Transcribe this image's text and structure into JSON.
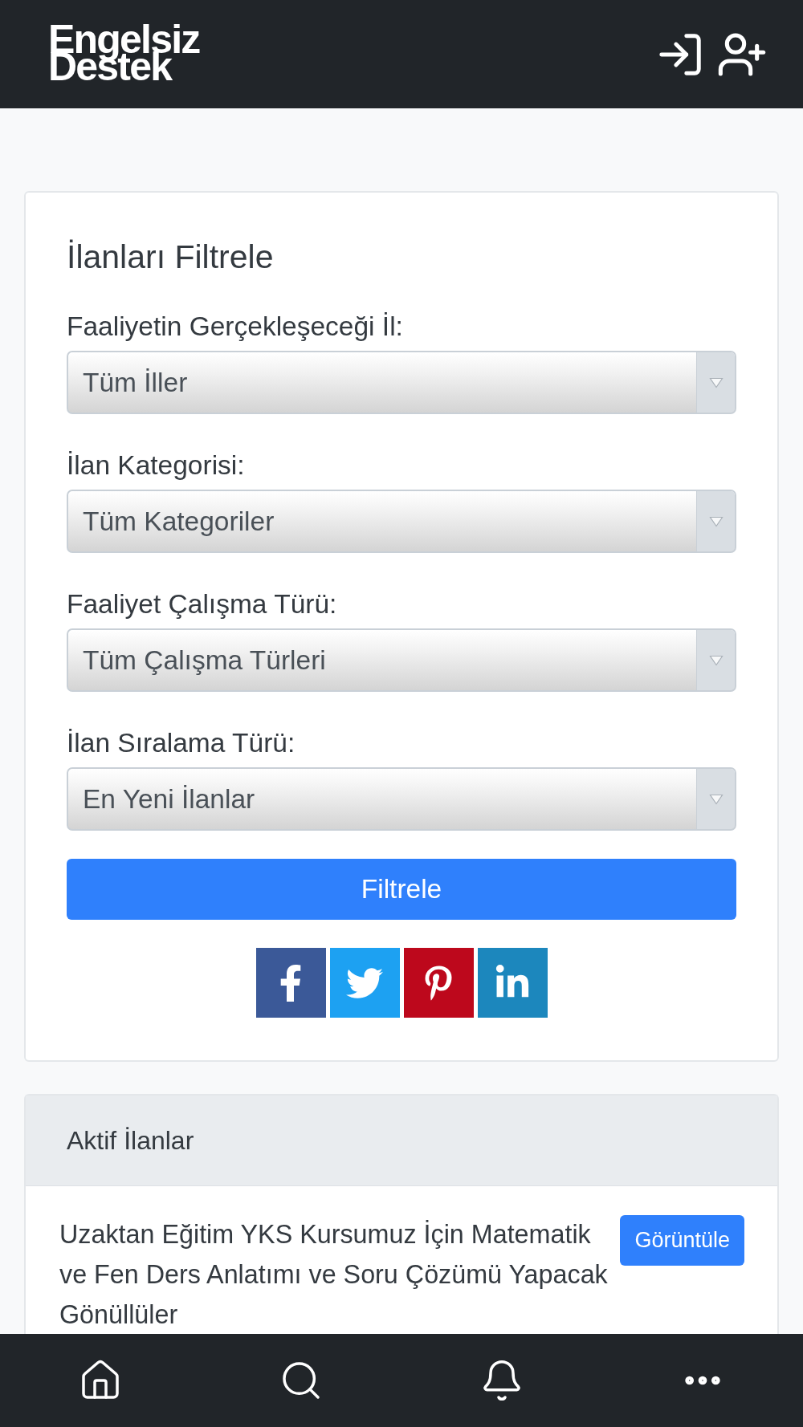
{
  "header": {
    "logo": "Engelsiz Destek"
  },
  "filter_panel": {
    "title": "İlanları Filtrele",
    "filters": [
      {
        "label": "Faaliyetin Gerçekleşeceği İl:",
        "value": "Tüm İller"
      },
      {
        "label": "İlan Kategorisi:",
        "value": "Tüm Kategoriler"
      },
      {
        "label": "Faaliyet Çalışma Türü:",
        "value": "Tüm Çalışma Türleri"
      },
      {
        "label": "İlan Sıralama Türü:",
        "value": "En Yeni İlanlar"
      }
    ],
    "submit": "Filtrele",
    "share_buttons": [
      {
        "kind": "facebook",
        "color": "#3b5998"
      },
      {
        "kind": "twitter",
        "color": "#1da1f2"
      },
      {
        "kind": "pinterest",
        "color": "#bd081c"
      },
      {
        "kind": "linkedin",
        "color": "#1c87bd"
      }
    ]
  },
  "active_listings": {
    "title": "Aktif İlanlar",
    "items": [
      {
        "title": "Uzaktan Eğitim YKS Kursumuz İçin Matematik ve Fen Ders Anlatımı ve Soru Çözümü Yapacak Gönüllüler",
        "button": "Görüntüle"
      }
    ]
  }
}
